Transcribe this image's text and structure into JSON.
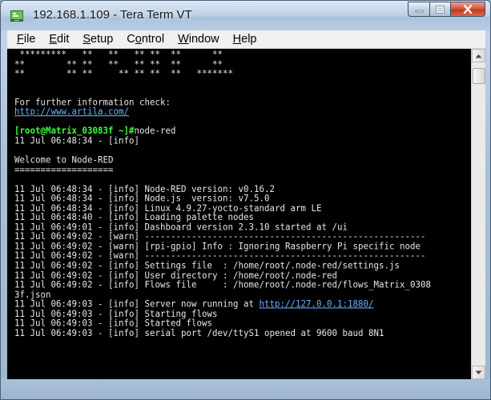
{
  "window": {
    "title": "192.168.1.109 - Tera Term VT",
    "icon": "tera-term-icon",
    "caption_buttons": [
      "minimize-icon",
      "maximize-icon",
      "close-icon"
    ]
  },
  "menu": [
    {
      "accel": "F",
      "rest": "ile"
    },
    {
      "accel": "E",
      "rest": "dit"
    },
    {
      "accel": "S",
      "rest": "etup"
    },
    {
      "accel": "",
      "pre": "C",
      "accel2": "o",
      "rest": "ntrol"
    },
    {
      "accel": "W",
      "rest": "indow"
    },
    {
      "accel": "H",
      "rest": "elp"
    }
  ],
  "terminal": {
    "lines": [
      [
        {
          "t": " *********   **   **   ** **  **      **"
        }
      ],
      [
        {
          "t": "**        ** **   **   ** **  **      **"
        }
      ],
      [
        {
          "t": "**        ** **     ** ** **  **   *******"
        }
      ],
      [
        {
          "t": ""
        }
      ],
      [
        {
          "t": ""
        }
      ],
      [
        {
          "t": "For further information check:"
        }
      ],
      [
        {
          "t": "http://www.artila.com/",
          "c": "link"
        }
      ],
      [
        {
          "t": ""
        }
      ],
      [
        {
          "t": "[root@Matrix_03083f ~]#",
          "c": "prompt"
        },
        {
          "t": "node-red"
        }
      ],
      [
        {
          "t": "11 Jul 06:48:34 - [info]"
        }
      ],
      [
        {
          "t": ""
        }
      ],
      [
        {
          "t": "Welcome to Node-RED"
        }
      ],
      [
        {
          "t": "==================="
        }
      ],
      [
        {
          "t": ""
        }
      ],
      [
        {
          "t": "11 Jul 06:48:34 - [info] Node-RED version: v0.16.2"
        }
      ],
      [
        {
          "t": "11 Jul 06:48:34 - [info] Node.js  version: v7.5.0"
        }
      ],
      [
        {
          "t": "11 Jul 06:48:34 - [info] Linux 4.9.27-yocto-standard arm LE"
        }
      ],
      [
        {
          "t": "11 Jul 06:48:40 - [info] Loading palette nodes"
        }
      ],
      [
        {
          "t": "11 Jul 06:49:01 - [info] Dashboard version 2.3.10 started at /ui"
        }
      ],
      [
        {
          "t": "11 Jul 06:49:02 - [warn] ------------------------------------------------------"
        }
      ],
      [
        {
          "t": "11 Jul 06:49:02 - [warn] [rpi-gpio] Info : Ignoring Raspberry Pi specific node"
        }
      ],
      [
        {
          "t": "11 Jul 06:49:02 - [warn] ------------------------------------------------------"
        }
      ],
      [
        {
          "t": "11 Jul 06:49:02 - [info] Settings file  : /home/root/.node-red/settings.js"
        }
      ],
      [
        {
          "t": "11 Jul 06:49:02 - [info] User directory : /home/root/.node-red"
        }
      ],
      [
        {
          "t": "11 Jul 06:49:02 - [info] Flows file     : /home/root/.node-red/flows_Matrix_0308"
        }
      ],
      [
        {
          "t": "3f.json"
        }
      ],
      [
        {
          "t": "11 Jul 06:49:03 - [info] Server now running at "
        },
        {
          "t": "http://127.0.0.1:1880/",
          "c": "link"
        }
      ],
      [
        {
          "t": "11 Jul 06:49:03 - [info] Starting flows"
        }
      ],
      [
        {
          "t": "11 Jul 06:49:03 - [info] Started flows"
        }
      ],
      [
        {
          "t": "11 Jul 06:49:03 - [info] serial port /dev/ttyS1 opened at 9600 baud 8N1"
        }
      ]
    ]
  },
  "scrollbar": {
    "up_icon": "scroll-up-arrow-icon",
    "down_icon": "scroll-down-arrow-icon",
    "position": 0
  },
  "colors": {
    "terminal_bg": "#000000",
    "terminal_fg": "#e8e8e8",
    "link": "#69b4ff",
    "prompt": "#39ff39",
    "close_button": "#c23a20"
  }
}
